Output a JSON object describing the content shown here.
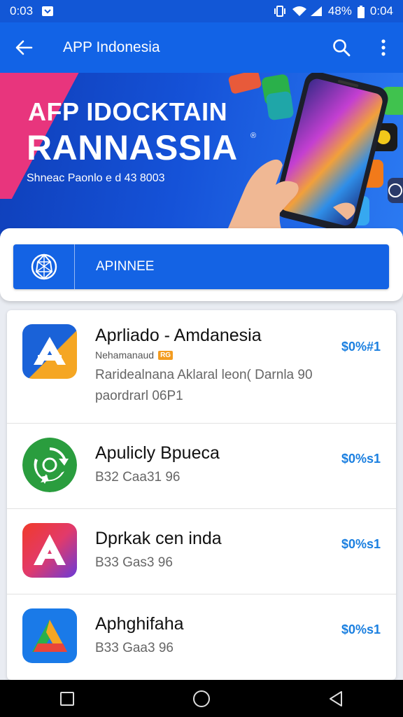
{
  "status_bar": {
    "time": "0:03",
    "battery": "48%",
    "clock_right": "0:04"
  },
  "app_bar": {
    "title": "APP Indonesia"
  },
  "banner": {
    "title_line1": "AFP IDOCKTAIN",
    "title_line2": "RANNASSIA",
    "reg_mark": "®",
    "subtitle": "Shneac Paonlo e d 43 8003"
  },
  "search": {
    "placeholder": "APINNEE"
  },
  "apps": [
    {
      "name": "Aprliado - Amdanesia",
      "developer": "Nehamanaud",
      "badge": "RG",
      "description": "Raridealnana Aklaral leon( Darnla 90 paordrarl 06P1",
      "price": "$0%#1",
      "icon": "a-letter-blue-orange-icon"
    },
    {
      "name": "Apulicly Bpueca",
      "meta": "B32 Caa31 96",
      "price": "$0%s1",
      "icon": "green-recycle-icon"
    },
    {
      "name": "Dprkak cen inda",
      "meta": "B33 Gas3 96",
      "price": "$0%s1",
      "icon": "a-letter-red-purple-icon"
    },
    {
      "name": "Aphghifaha",
      "meta": "B33 Gaa3 96",
      "price": "$0%s1",
      "icon": "a-letter-multicolor-icon"
    }
  ],
  "colors": {
    "primary": "#1263e6",
    "price": "#1a7fe0",
    "accent_pink": "#e8357d"
  }
}
